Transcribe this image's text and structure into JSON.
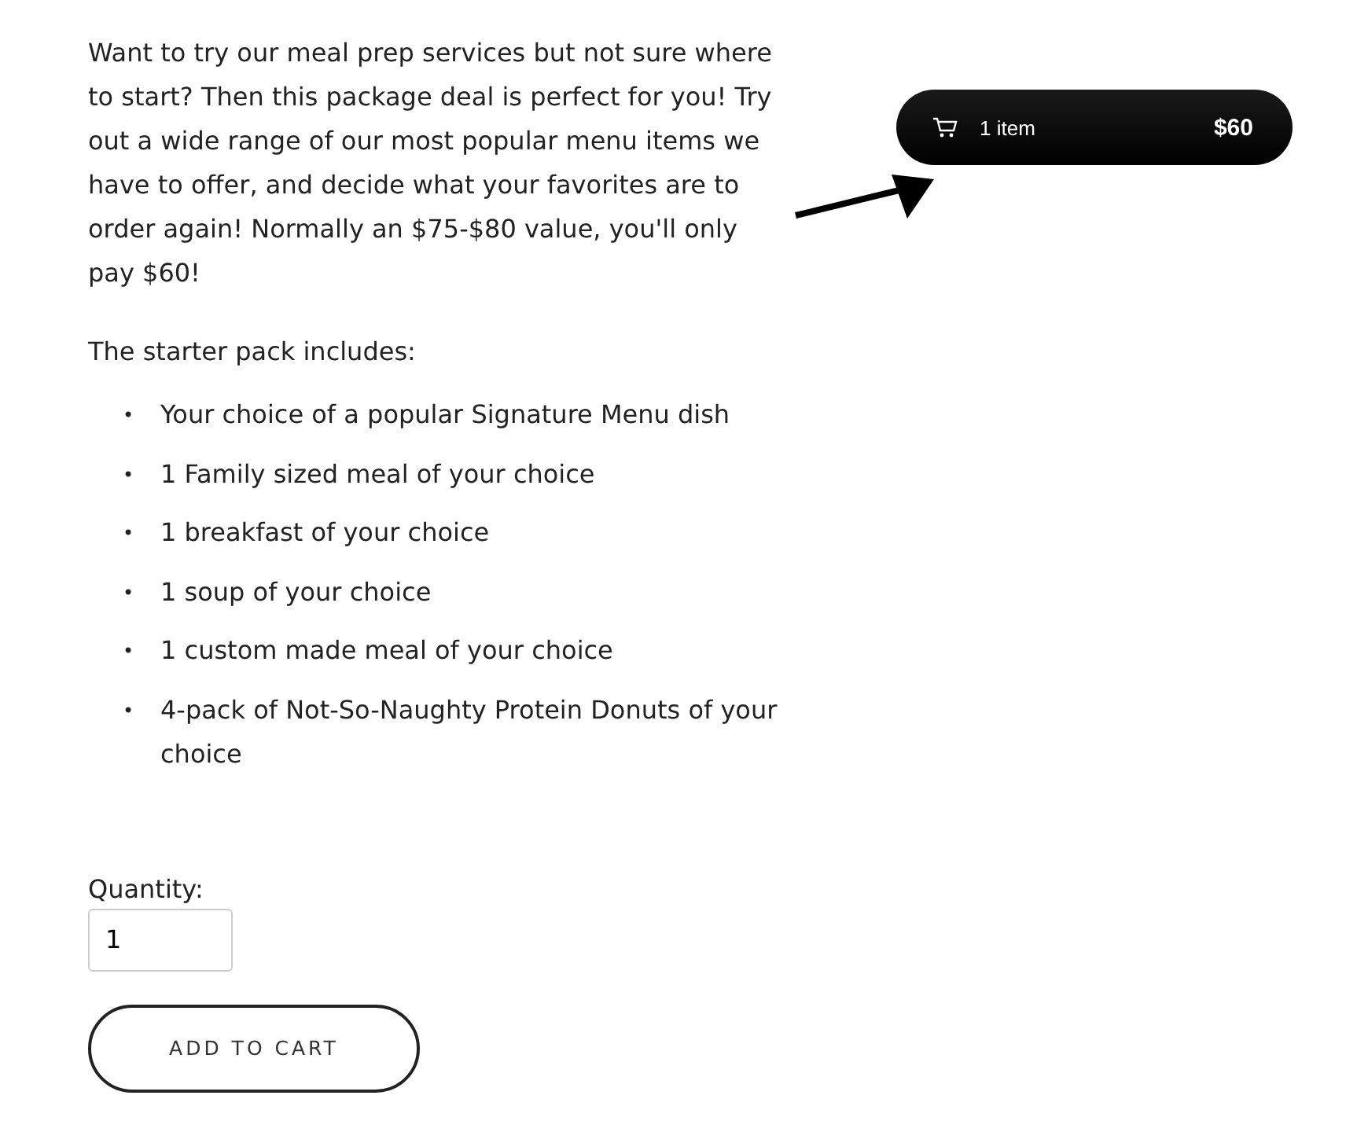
{
  "description": "Want to try our meal prep services but not sure where to start? Then this package deal is perfect for you! Try out a wide range of our most popular menu items we have to offer, and decide what your favorites are to order again! Normally an $75-$80 value, you'll only pay $60!",
  "includes_heading": "The starter pack includes:",
  "includes": [
    {
      "bullet": "•",
      "text": "Your choice of a popular Signature Menu dish"
    },
    {
      "bullet": "•",
      "text": "1 Family sized meal of your choice"
    },
    {
      "bullet": "•",
      "text": "1 breakfast of your choice"
    },
    {
      "bullet": "•",
      "text": "1 soup of your choice"
    },
    {
      "bullet": "•",
      "text": "1 custom made meal of your choice"
    },
    {
      "bullet": "•",
      "text": "4-pack of Not-So-Naughty Protein Donuts of your choice"
    }
  ],
  "quantity": {
    "label": "Quantity:",
    "value": "1"
  },
  "add_button": "ADD TO CART",
  "cart": {
    "count": "1 item",
    "total": "$60"
  }
}
